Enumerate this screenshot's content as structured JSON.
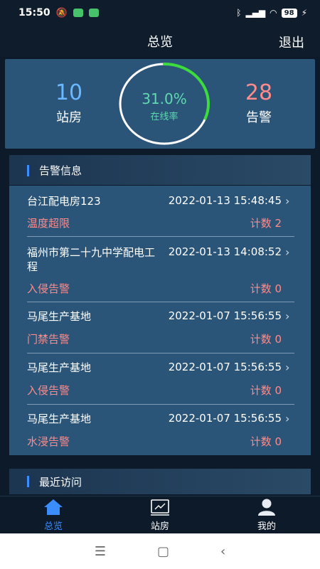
{
  "status_bar": {
    "time": "15:50",
    "battery": "98"
  },
  "header": {
    "title": "总览",
    "logout_label": "退出"
  },
  "summary": {
    "stations_count": "10",
    "stations_label": "站房",
    "online_rate": "31.0%",
    "online_rate_value": 0.31,
    "online_rate_label": "在线率",
    "alarms_count": "28",
    "alarms_label": "告警"
  },
  "alerts": {
    "title": "告警信息",
    "items": [
      {
        "name": "台江配电房123",
        "time": "2022-01-13 15:48:45",
        "type": "温度超限",
        "count": "计数 2"
      },
      {
        "name": "福州市第二十九中学配电工程",
        "time": "2022-01-13 14:08:52",
        "type": "入侵告警",
        "count": "计数 0"
      },
      {
        "name": "马尾生产基地",
        "time": "2022-01-07 15:56:55",
        "type": "门禁告警",
        "count": "计数 0"
      },
      {
        "name": "马尾生产基地",
        "time": "2022-01-07 15:56:55",
        "type": "入侵告警",
        "count": "计数 0"
      },
      {
        "name": "马尾生产基地",
        "time": "2022-01-07 15:56:55",
        "type": "水浸告警",
        "count": "计数 0"
      }
    ]
  },
  "recent": {
    "title": "最近访问"
  },
  "tabs": [
    {
      "label": "总览",
      "icon": "home-icon",
      "active": true
    },
    {
      "label": "站房",
      "icon": "station-icon",
      "active": false
    },
    {
      "label": "我的",
      "icon": "user-icon",
      "active": false
    }
  ],
  "colors": {
    "panel": "#2a5478",
    "background": "#0c1a2a",
    "accent": "#3b8cff",
    "alarm": "#ff8b8b",
    "online": "#5fd9b0"
  }
}
